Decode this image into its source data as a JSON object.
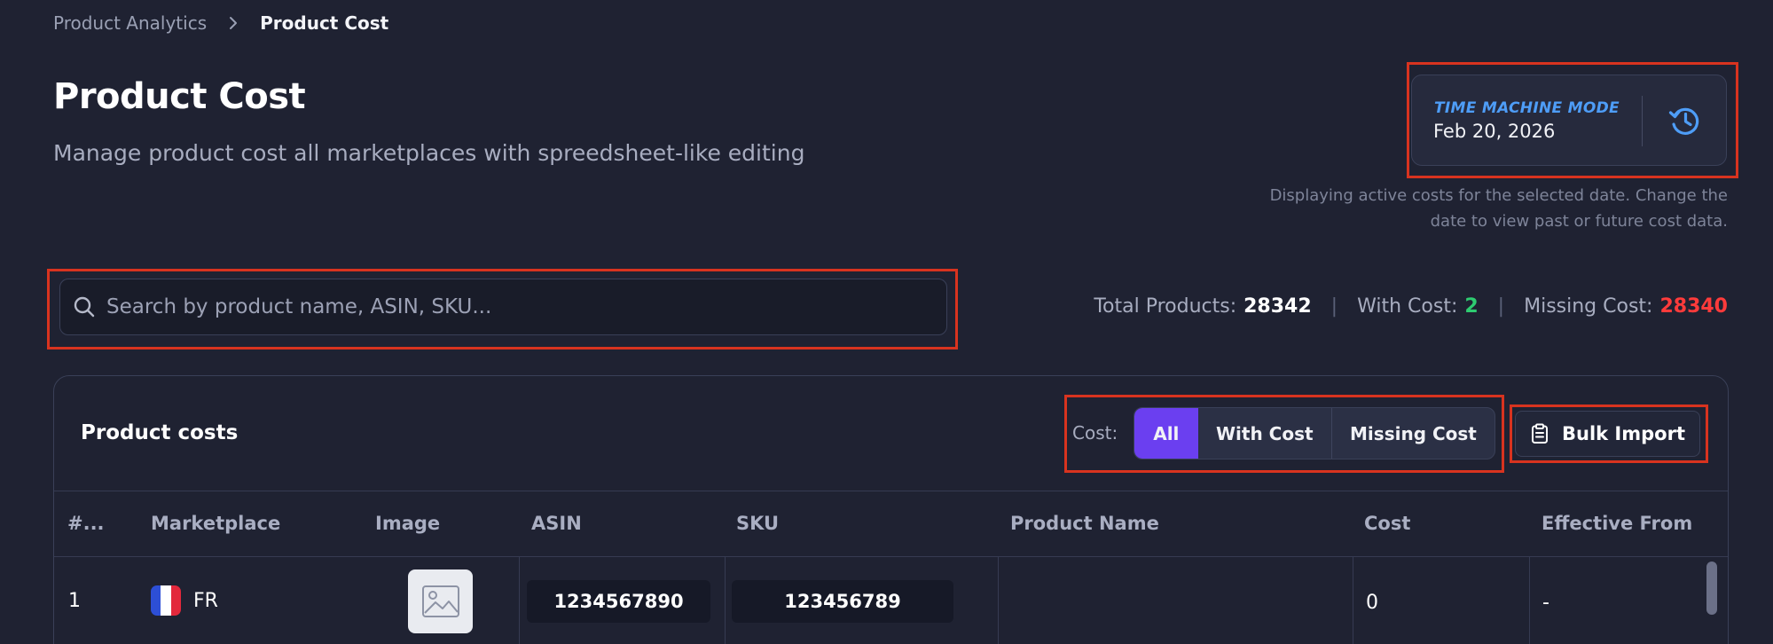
{
  "breadcrumb": {
    "parent": "Product Analytics",
    "current": "Product Cost"
  },
  "page": {
    "title": "Product Cost",
    "subtitle": "Manage product cost all marketplaces with spreedsheet-like editing"
  },
  "time_machine": {
    "label": "TIME MACHINE MODE",
    "date": "Feb 20, 2026",
    "note_line1": "Displaying active costs for the selected date. Change the",
    "note_line2": "date to view past or future cost data."
  },
  "search": {
    "placeholder": "Search by product name, ASIN, SKU...",
    "value": ""
  },
  "stats": {
    "total_label": "Total Products:",
    "total_value": "28342",
    "with_label": "With Cost:",
    "with_value": "2",
    "missing_label": "Missing Cost:",
    "missing_value": "28340",
    "separator": "|"
  },
  "panel": {
    "title": "Product costs",
    "filter_label": "Cost:",
    "filters": [
      "All",
      "With Cost",
      "Missing Cost"
    ],
    "selected_filter": "All",
    "bulk_import_label": "Bulk Import"
  },
  "table": {
    "columns": [
      "#...",
      "Marketplace",
      "Image",
      "ASIN",
      "SKU",
      "Product Name",
      "Cost",
      "Effective From"
    ],
    "rows": [
      {
        "index": "1",
        "marketplace": "FR",
        "asin": "1234567890",
        "sku": "123456789",
        "product_name": "",
        "cost": "0",
        "effective_from": "-"
      }
    ]
  },
  "colors": {
    "background": "#1f2232",
    "accent": "#6b3ff0",
    "time_machine_label": "#4e9df7",
    "with_cost": "#2ecc71",
    "missing_cost": "#ff3b3b",
    "highlight_outline": "#d8331f"
  },
  "icons": {
    "breadcrumb_separator": "chevron-right-icon",
    "time_machine": "history-icon",
    "search": "search-icon",
    "bulk_import": "clipboard-icon",
    "image_placeholder": "image-placeholder-icon",
    "flag": "france-flag-icon"
  }
}
